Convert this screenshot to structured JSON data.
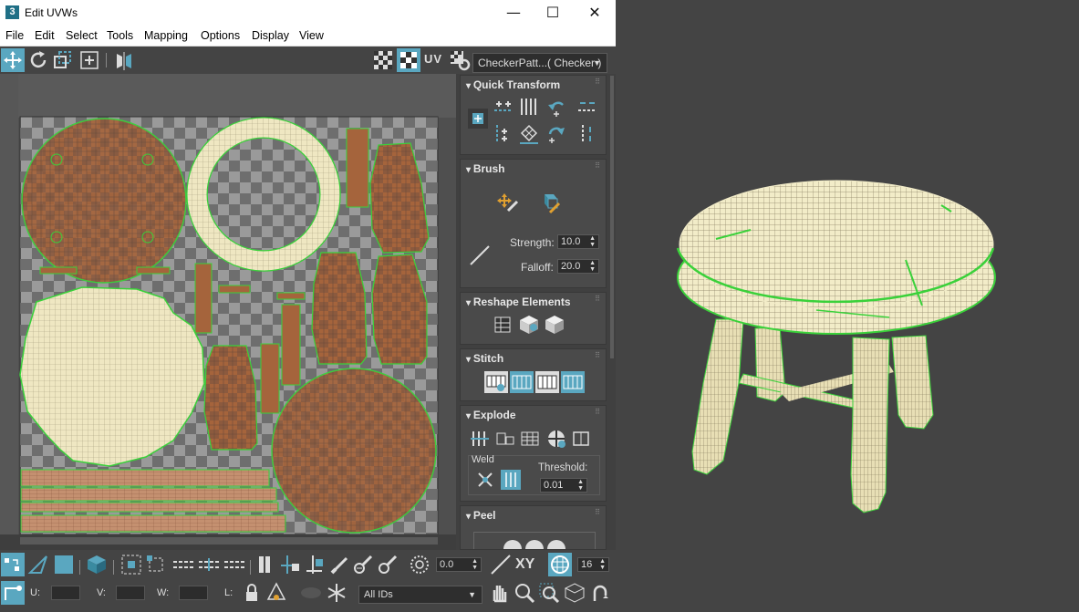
{
  "window": {
    "app_icon": "3",
    "title": "Edit UVWs",
    "minimize": "—",
    "maximize": "☐",
    "close": "✕"
  },
  "menu": [
    "File",
    "Edit",
    "Select",
    "Tools",
    "Mapping",
    "Options",
    "Display",
    "View"
  ],
  "toolbar": {
    "uv_label": "UV",
    "texture_combo": "CheckerPatt...( Checker )"
  },
  "panels": {
    "quick_transform": {
      "title": "Quick Transform"
    },
    "brush": {
      "title": "Brush",
      "strength_label": "Strength:",
      "strength_value": "10.0",
      "falloff_label": "Falloff:",
      "falloff_value": "20.0"
    },
    "reshape": {
      "title": "Reshape Elements"
    },
    "stitch": {
      "title": "Stitch"
    },
    "explode": {
      "title": "Explode",
      "weld_label": "Weld",
      "threshold_label": "Threshold:",
      "threshold_value": "0.01"
    },
    "peel": {
      "title": "Peel"
    }
  },
  "bottom": {
    "angle_value": "0.0",
    "xy_label": "XY",
    "count_value": "16",
    "u_label": "U:",
    "v_label": "V:",
    "w_label": "W:",
    "l_label": "L:",
    "ids_combo": "All IDs"
  },
  "colors": {
    "accent": "#5aa7c0",
    "uv_edge": "#3ad13a",
    "uv_face": "#b06a3c",
    "mesh": "#f2ecc8"
  }
}
